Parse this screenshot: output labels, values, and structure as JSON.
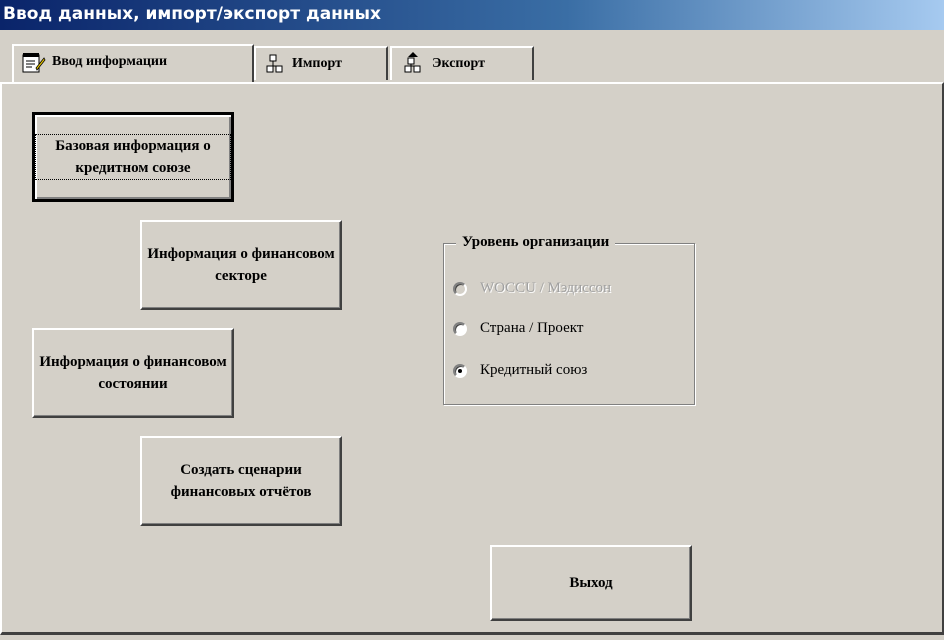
{
  "window": {
    "title": "Ввод данных, импорт/экспорт данных"
  },
  "tabs": [
    {
      "label": "Ввод информации",
      "icon": "notepad-pencil-icon",
      "active": true
    },
    {
      "label": "Импорт",
      "icon": "import-icon",
      "active": false
    },
    {
      "label": "Экспорт",
      "icon": "export-icon",
      "active": false
    }
  ],
  "buttons": {
    "base_info": "Базовая информация о кредитном союзе",
    "fin_sector": "Информация о финансовом секторе",
    "fin_state": "Информация о финансовом состоянии",
    "scenarios": "Создать сценарии финансовых отчётов",
    "exit": "Выход"
  },
  "org_level": {
    "title": "Уровень организации",
    "options": [
      {
        "label": "WOCCU / Мэдиссон",
        "enabled": false,
        "selected": false
      },
      {
        "label": "Страна / Проект",
        "enabled": true,
        "selected": false
      },
      {
        "label": "Кредитный союз",
        "enabled": true,
        "selected": true
      }
    ]
  }
}
